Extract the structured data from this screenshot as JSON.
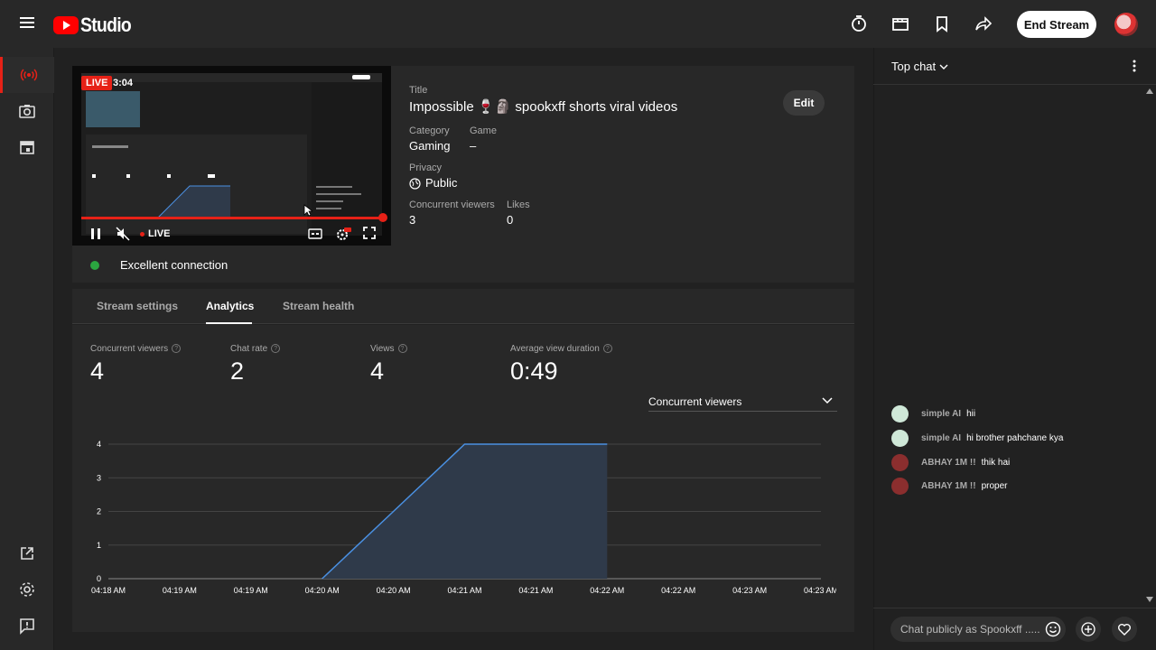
{
  "app": {
    "logo_text": "Studio",
    "end_stream_label": "End Stream"
  },
  "preview": {
    "live_badge": "LIVE",
    "elapsed": "3:04",
    "live_label": "LIVE"
  },
  "stream_info": {
    "title_label": "Title",
    "title": "Impossible 🍷🗿 spookxff shorts viral videos",
    "edit_label": "Edit",
    "category_label": "Category",
    "category": "Gaming",
    "game_label": "Game",
    "game": "–",
    "privacy_label": "Privacy",
    "privacy": "Public",
    "concurrent_label": "Concurrent viewers",
    "concurrent": "3",
    "likes_label": "Likes",
    "likes": "0"
  },
  "connection": {
    "status": "Excellent connection"
  },
  "tabs": [
    {
      "label": "Stream settings"
    },
    {
      "label": "Analytics"
    },
    {
      "label": "Stream health"
    }
  ],
  "stats": [
    {
      "label": "Concurrent viewers",
      "value": "4"
    },
    {
      "label": "Chat rate",
      "value": "2"
    },
    {
      "label": "Views",
      "value": "4"
    },
    {
      "label": "Average view duration",
      "value": "0:49"
    }
  ],
  "metric_select": {
    "value": "Concurrent viewers"
  },
  "chart_data": {
    "type": "area",
    "x": [
      "04:18 AM",
      "04:19 AM",
      "04:19 AM",
      "04:20 AM",
      "04:20 AM",
      "04:21 AM",
      "04:21 AM",
      "04:22 AM",
      "04:22 AM",
      "04:23 AM",
      "04:23 AM"
    ],
    "y_ticks": [
      "0",
      "1",
      "2",
      "3",
      "4"
    ],
    "ylim": [
      0,
      4
    ],
    "series": [
      {
        "values": [
          null,
          null,
          null,
          0,
          2,
          4,
          4,
          4,
          null,
          null,
          null
        ]
      }
    ],
    "color": "#4a90e2",
    "grid": true
  },
  "chat": {
    "mode": "Top chat",
    "messages": [
      {
        "author": "simple AI",
        "text": "hii",
        "avatar_color": "#cfe8d8"
      },
      {
        "author": "simple AI",
        "text": "hi brother pahchane kya",
        "avatar_color": "#cfe8d8"
      },
      {
        "author": "ABHAY 1M !!",
        "text": "thik hai",
        "avatar_color": "#8b2e2e"
      },
      {
        "author": "ABHAY 1M !!",
        "text": "proper",
        "avatar_color": "#8b2e2e"
      }
    ],
    "input_placeholder": "Chat publicly as Spookxff ....."
  }
}
